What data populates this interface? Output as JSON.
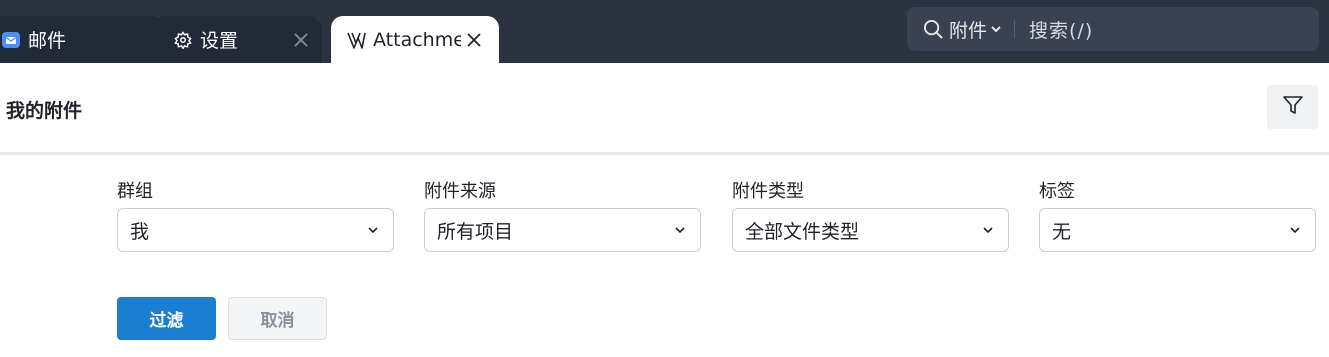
{
  "tabs": [
    {
      "label": "邮件",
      "icon": "mail-icon"
    },
    {
      "label": "设置",
      "icon": "gear-icon"
    },
    {
      "label": "Attachments",
      "icon": "attachment-app-icon"
    }
  ],
  "search": {
    "scope": "附件",
    "placeholder": "搜索(/)"
  },
  "page": {
    "title": "我的附件"
  },
  "filters": [
    {
      "label": "群组",
      "value": "我"
    },
    {
      "label": "附件来源",
      "value": "所有项目"
    },
    {
      "label": "附件类型",
      "value": "全部文件类型"
    },
    {
      "label": "标签",
      "value": "无"
    }
  ],
  "actions": {
    "apply": "过滤",
    "cancel": "取消"
  },
  "colors": {
    "topbar": "#2b3240",
    "primary": "#1a7fd1",
    "mail_icon": "#4a8df6"
  }
}
